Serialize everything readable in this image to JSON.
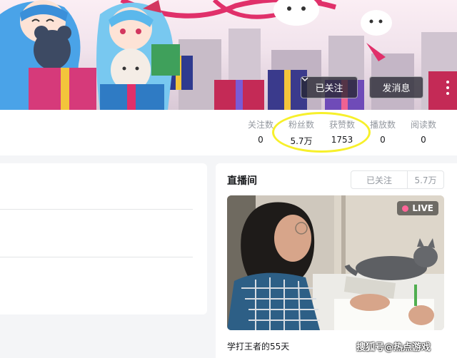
{
  "header": {
    "follow_label": "已关注",
    "message_label": "发消息"
  },
  "stats": [
    {
      "label": "关注数",
      "value": "0"
    },
    {
      "label": "粉丝数",
      "value": "5.7万"
    },
    {
      "label": "获赞数",
      "value": "1753"
    },
    {
      "label": "播放数",
      "value": "0"
    },
    {
      "label": "阅读数",
      "value": "0"
    }
  ],
  "live": {
    "title": "直播间",
    "followed_label": "已关注",
    "fans_count": "5.7万",
    "badge": "LIVE",
    "room_title": "学打王者的55天"
  },
  "watermark": "搜狐号@热点游戏",
  "colors": {
    "highlight_oval": "#f7f02b",
    "live_dot": "#ff6699"
  }
}
